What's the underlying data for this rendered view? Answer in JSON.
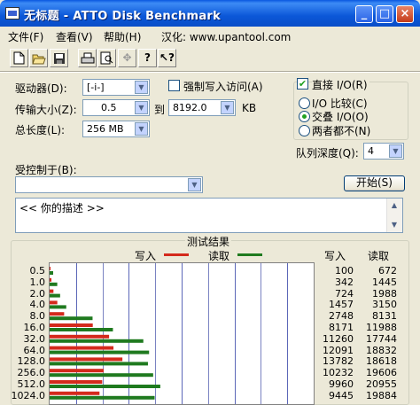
{
  "window": {
    "title": "无标题 - ATTO Disk Benchmark",
    "minimize": "_",
    "maximize": "□",
    "close": "×"
  },
  "menu": {
    "file": "文件(F)",
    "view": "查看(V)",
    "help": "帮助(H)",
    "localized": "汉化: www.upantool.com"
  },
  "toolbar": {
    "icons": [
      "new-document-icon",
      "open-folder-icon",
      "save-disk-icon",
      "print-icon",
      "print-preview-icon",
      "move-icon",
      "help-icon",
      "context-help-icon"
    ]
  },
  "settings": {
    "drive_label": "驱动器(D):",
    "drive_value": "[-i-]",
    "force_write_label": "强制写入访问(A)",
    "force_write_checked": false,
    "transfer_label": "传输大小(Z):",
    "transfer_from": "0.5",
    "to_label": "到",
    "transfer_to": "8192.0",
    "unit": "KB",
    "length_label": "总长度(L):",
    "length_value": "256 MB",
    "direct_io_label": "直接 I/O(R)",
    "direct_io_checked": true,
    "io_compare_label": "I/O 比较(C)",
    "overlapped_io_label": "交叠 I/O(O)",
    "neither_label": "两者都不(N)",
    "selected_mode": "overlapped_io",
    "queue_depth_label": "队列深度(Q):",
    "queue_depth_value": "4",
    "controlled_by_label": "受控制于(B):",
    "controlled_by_value": "",
    "start_button": "开始(S)",
    "description": "<<  你的描述  >>"
  },
  "results": {
    "title": "测试结果",
    "write_legend": "写入",
    "read_legend": "读取",
    "write_header": "写入",
    "read_header": "读取",
    "write_color": "#d42a1c",
    "read_color": "#1f7a1f"
  },
  "chart_data": {
    "type": "bar",
    "orientation": "horizontal",
    "categories": [
      "0.5",
      "1.0",
      "2.0",
      "4.0",
      "8.0",
      "16.0",
      "32.0",
      "64.0",
      "128.0",
      "256.0",
      "512.0",
      "1024.0"
    ],
    "series": [
      {
        "name": "写入",
        "values": [
          100,
          342,
          724,
          1457,
          2748,
          8171,
          11260,
          12091,
          13782,
          10232,
          9960,
          9445
        ]
      },
      {
        "name": "读取",
        "values": [
          672,
          1445,
          1988,
          3150,
          8131,
          11988,
          17744,
          18832,
          18618,
          19606,
          20955,
          19884
        ]
      }
    ],
    "xlim": [
      0,
      50000
    ],
    "grid": true
  }
}
